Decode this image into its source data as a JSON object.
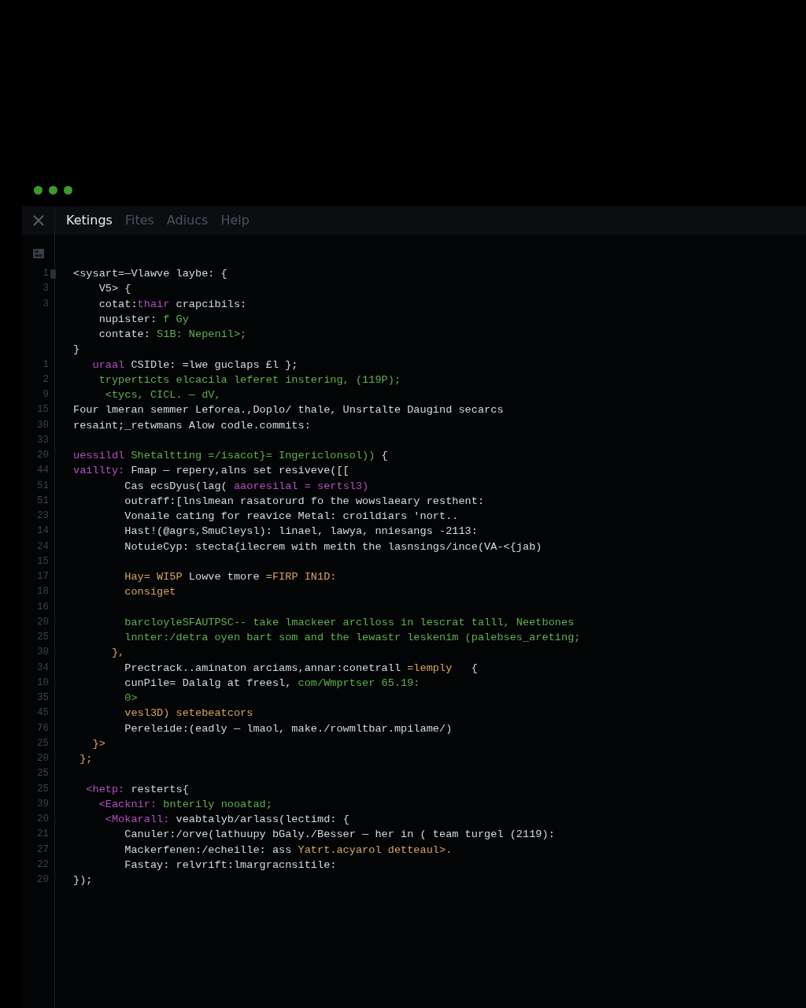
{
  "menu": [
    {
      "label": "Ketings",
      "selected": true
    },
    {
      "label": "Fites",
      "selected": false
    },
    {
      "label": "Adiucs",
      "selected": false
    },
    {
      "label": "Help",
      "selected": false
    }
  ],
  "editor": {
    "lines": [
      {
        "number": "1",
        "marked": true,
        "segments": [
          {
            "text": "<sysart=—Vlawve laybe: {",
            "kind": "plain"
          }
        ]
      },
      {
        "number": "3",
        "marked": false,
        "segments": [
          {
            "text": "    V5> {",
            "kind": "plain"
          }
        ]
      },
      {
        "number": "3",
        "marked": false,
        "segments": [
          {
            "text": "    cotat:",
            "kind": "plain"
          },
          {
            "text": "thair",
            "kind": "keyword"
          },
          {
            "text": " crapcibils:",
            "kind": "plain"
          }
        ]
      },
      {
        "marked": false,
        "segments": [
          {
            "text": "    nupister: ",
            "kind": "plain"
          },
          {
            "text": "f Gy",
            "kind": "string"
          }
        ]
      },
      {
        "marked": false,
        "segments": [
          {
            "text": "    contate: ",
            "kind": "plain"
          },
          {
            "text": "S1B: Nepenil>;",
            "kind": "string"
          }
        ]
      },
      {
        "marked": false,
        "segments": [
          {
            "text": "}",
            "kind": "plain"
          }
        ]
      },
      {
        "number": "1",
        "marked": false,
        "segments": [
          {
            "text": "   urаal",
            "kind": "keyword"
          },
          {
            "text": " CSIDle: =lwe guclaps £l };",
            "kind": "plain"
          }
        ]
      },
      {
        "number": "2",
        "marked": false,
        "segments": [
          {
            "text": "    tryperticts elcacila leferet instering, (119P);",
            "kind": "string"
          }
        ]
      },
      {
        "number": "9",
        "marked": false,
        "segments": [
          {
            "text": "     <tycs, CICL. — dV,",
            "kind": "string"
          }
        ]
      },
      {
        "number": "15",
        "marked": false,
        "segments": [
          {
            "text": "Four lmeran semmer Leforea.,Doplo/ thale, Unsrtalte Daugind secarcs",
            "kind": "plain"
          }
        ]
      },
      {
        "number": "30",
        "marked": false,
        "segments": [
          {
            "text": "resaint;_retwmans Alow codle.commits:",
            "kind": "plain"
          }
        ]
      },
      {
        "number": "33",
        "marked": false
      },
      {
        "number": "20",
        "marked": false,
        "segments": [
          {
            "text": "uessildl",
            "kind": "keyword"
          },
          {
            "text": " Shetaltting =/isacot}= Ingericlonsol))",
            "kind": "string"
          },
          {
            "text": " {",
            "kind": "plain"
          }
        ]
      },
      {
        "number": "44",
        "marked": false,
        "segments": [
          {
            "text": "vaillty:",
            "kind": "keyword"
          },
          {
            "text": " Fmap — repery,alns set resiveve([[",
            "kind": "plain"
          }
        ]
      },
      {
        "number": "51",
        "marked": false,
        "segments": [
          {
            "text": "        Cas ecsDyus(lag( ",
            "kind": "plain"
          },
          {
            "text": "aaoresilal = sertsl3)",
            "kind": "keyword"
          }
        ]
      },
      {
        "number": "51",
        "marked": false,
        "segments": [
          {
            "text": "        outraff:[lnslmean rasatorurd fo the wowslaeary resthent:",
            "kind": "plain"
          }
        ]
      },
      {
        "number": "23",
        "marked": false,
        "segments": [
          {
            "text": "        Vonaile cating for reavice Metal: croildiars 'nort..",
            "kind": "plain"
          }
        ]
      },
      {
        "number": "14",
        "marked": false,
        "segments": [
          {
            "text": "        Hast!(@agrs,SmuCleysl): linael, lawya, nniesangs -2113:",
            "kind": "plain"
          }
        ]
      },
      {
        "number": "24",
        "marked": false,
        "segments": [
          {
            "text": "        NotuieCyp: stecta{ilecrem with meith the lasnsings/ince(VA-<{jab)",
            "kind": "plain"
          }
        ]
      },
      {
        "number": "15",
        "marked": false
      },
      {
        "number": "17",
        "marked": false,
        "segments": [
          {
            "text": "        Hay= WI5P",
            "kind": "number"
          },
          {
            "text": " Lowve tmore ",
            "kind": "plain"
          },
          {
            "text": "=FIRP IN1D:",
            "kind": "number"
          }
        ]
      },
      {
        "number": "18",
        "marked": false,
        "segments": [
          {
            "text": "        consiget",
            "kind": "number"
          }
        ]
      },
      {
        "number": "16",
        "marked": false
      },
      {
        "number": "20",
        "marked": false,
        "segments": [
          {
            "text": "        barcloyleSFAUTPSC-- take lmackeer arclloss in lescrat talll, Neetbones",
            "kind": "string"
          }
        ]
      },
      {
        "number": "25",
        "marked": false,
        "segments": [
          {
            "text": "        lnnter:/detra oyen bart som and the lewastr leskenim (palebses_areting;",
            "kind": "string"
          }
        ]
      },
      {
        "number": "30",
        "marked": false,
        "segments": [
          {
            "text": "      },",
            "kind": "number"
          }
        ]
      },
      {
        "number": "34",
        "marked": false,
        "segments": [
          {
            "text": "        Prectrack..aminaton arciams,annar:conetrall ",
            "kind": "plain"
          },
          {
            "text": "=lemply",
            "kind": "number"
          },
          {
            "text": "   {",
            "kind": "plain"
          }
        ]
      },
      {
        "number": "10",
        "marked": false,
        "segments": [
          {
            "text": "        cunPile= Dalalg at freesl, ",
            "kind": "plain"
          },
          {
            "text": "com/Wmprtser 65.19:",
            "kind": "string"
          }
        ]
      },
      {
        "number": "35",
        "marked": false,
        "segments": [
          {
            "text": "        0>",
            "kind": "string"
          }
        ]
      },
      {
        "number": "45",
        "marked": false,
        "segments": [
          {
            "text": "        vesl3D) setebeatcors",
            "kind": "number"
          }
        ]
      },
      {
        "number": "76",
        "marked": false,
        "segments": [
          {
            "text": "        Pereleide:(eadly — lmaol, make./rowmltbar.mpilame/)",
            "kind": "plain"
          }
        ]
      },
      {
        "number": "25",
        "marked": false,
        "segments": [
          {
            "text": "   }>",
            "kind": "number"
          }
        ]
      },
      {
        "number": "20",
        "marked": false,
        "segments": [
          {
            "text": " };",
            "kind": "number"
          }
        ]
      },
      {
        "number": "25",
        "marked": false
      },
      {
        "number": "25",
        "marked": false,
        "segments": [
          {
            "text": "  <hetp:",
            "kind": "keyword"
          },
          {
            "text": " resterts{",
            "kind": "plain"
          }
        ]
      },
      {
        "number": "39",
        "marked": false,
        "segments": [
          {
            "text": "    <Eacknir:",
            "kind": "keyword"
          },
          {
            "text": " bnterily nooatad;",
            "kind": "string"
          }
        ]
      },
      {
        "number": "20",
        "marked": false,
        "segments": [
          {
            "text": "     <Mokarall:",
            "kind": "keyword"
          },
          {
            "text": " veabtalyb/arlass(lectimd: {",
            "kind": "plain"
          }
        ]
      },
      {
        "number": "21",
        "marked": false,
        "segments": [
          {
            "text": "        Canuler:/orve(lathuupy bGaly./Besser — her in ( team turgel (2119):",
            "kind": "plain"
          }
        ]
      },
      {
        "number": "27",
        "marked": false,
        "segments": [
          {
            "text": "        Mackerfenen:/echeille: ass ",
            "kind": "plain"
          },
          {
            "text": "Yatrt.acyarol detteaul>.",
            "kind": "number"
          }
        ]
      },
      {
        "number": "22",
        "marked": false,
        "segments": [
          {
            "text": "        Fastay: relvrift:lmargracnsitile:",
            "kind": "plain"
          }
        ]
      },
      {
        "number": "20",
        "marked": false,
        "segments": [
          {
            "text": "});",
            "kind": "plain"
          }
        ]
      }
    ]
  }
}
